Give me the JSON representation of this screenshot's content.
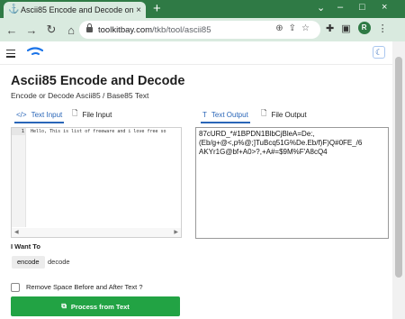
{
  "browser": {
    "tab_title": "Ascii85 Encode and Decode on T",
    "tab_close": "×",
    "new_tab": "+",
    "window_controls": [
      "⌄",
      "–",
      "□",
      "×"
    ],
    "url_host": "toolkitbay.com",
    "url_path": "/tkb/tool/ascii85",
    "nav_icons": {
      "back": "←",
      "forward": "→",
      "reload": "↻",
      "home": "⌂"
    },
    "profile_initial": "R"
  },
  "header": {
    "logo_color": "#1a73e8",
    "theme_icon": "☾"
  },
  "main": {
    "title": "Ascii85 Encode and Decode",
    "subtitle": "Encode or Decode Ascii85 / Base85 Text",
    "input_tabs": [
      {
        "icon": "</>",
        "label": "Text Input"
      },
      {
        "icon": "🗋",
        "label": "File Input"
      }
    ],
    "output_tabs": [
      {
        "icon": "T",
        "label": "Text Output"
      },
      {
        "icon": "🗋",
        "label": "File Output"
      }
    ],
    "editor": {
      "line_number": "1",
      "text": "Hello, This is list of freeware and i love free so"
    },
    "output_text": "87cURD_*#1BPDN1BlbCjBleA=De:,\n(Eb/g+@<,p%@;]TuBcq51G%De.Eb/f)F)Q#0FE_/6\nAKYr1G@bf+A0>?,+A#=$9M%F'A8cQ4",
    "want_label": "I Want To",
    "options": [
      "encode",
      "decode"
    ],
    "selected_option": "encode",
    "checkbox_label": "Remove Space Before and After Text ?",
    "process_button": "Process from Text",
    "accent_color": "#2a66b8",
    "button_color": "#22a344"
  }
}
